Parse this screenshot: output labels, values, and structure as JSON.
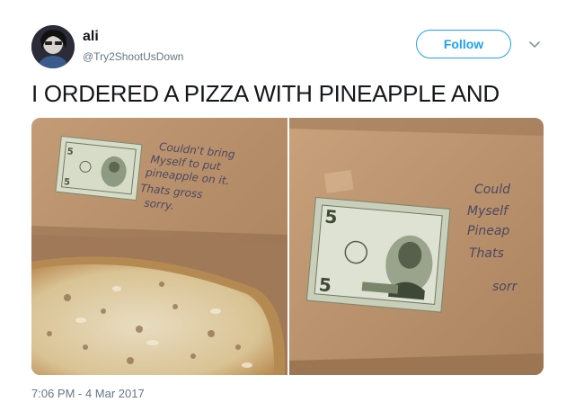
{
  "tweet": {
    "author": {
      "name": "ali",
      "handle": "@Try2ShootUsDown",
      "avatar_icon": "avatar-photo"
    },
    "follow_label": "Follow",
    "menu_icon": "chevron-down-icon",
    "text": "I ORDERED A PIZZA WITH PINEAPPLE AND",
    "timestamp": "7:06 PM - 4 Mar 2017",
    "media": {
      "left_photo": {
        "note_lines": [
          "Couldn't bring",
          "Myself to put",
          "pineapple on it.",
          "Thats gross",
          "sorry."
        ]
      },
      "right_photo": {
        "note_lines": [
          "Could",
          "Myself",
          "Pineap",
          "Thats",
          "sorr"
        ]
      }
    }
  },
  "colors": {
    "accent": "#1da1f2",
    "text_primary": "#14171a",
    "text_secondary": "#657786",
    "cardboard": "#b98f6a"
  }
}
